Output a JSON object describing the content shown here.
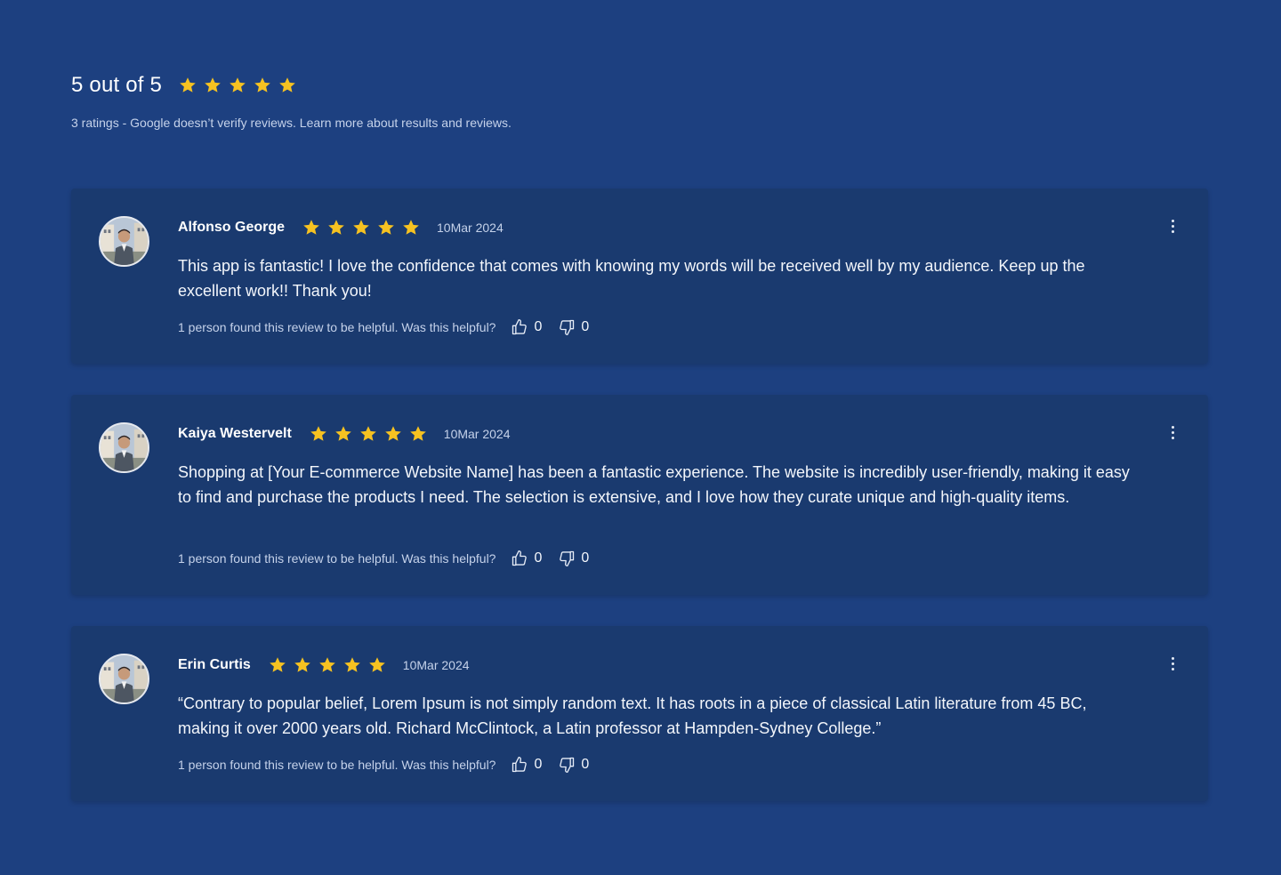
{
  "summary": {
    "title": "5 out of 5",
    "rating": 5,
    "rating_max": 5,
    "subtitle": "3 ratings - Google doesn’t verify reviews. Learn more about results and reviews."
  },
  "colors": {
    "background": "#1d4080",
    "card": "#1a3a6f",
    "star": "#f6c221",
    "muted_text": "#c5d2ea"
  },
  "icons": {
    "star": "star-icon",
    "menu": "more-vertical-icon",
    "like": "thumbs-up-icon",
    "dislike": "thumbs-down-icon"
  },
  "reviews": [
    {
      "name": "Alfonso George",
      "rating": 5,
      "date": "10Mar 2024",
      "text": "This app is fantastic! I love the confidence that comes with knowing my words will be received well by my audience. Keep up the excellent work!! Thank you!",
      "helpful_text": "1 person found this review to be helpful. Was this helpful?",
      "likes": "0",
      "dislikes": "0"
    },
    {
      "name": "Kaiya Westervelt",
      "rating": 5,
      "date": "10Mar 2024",
      "text": "Shopping at [Your E-commerce Website Name] has been a fantastic experience. The website is incredibly user-friendly, making it easy to find and purchase the products I need. The selection is extensive, and I love how they curate unique and high-quality items.",
      "helpful_text": "1 person found this review to be helpful. Was this helpful?",
      "likes": "0",
      "dislikes": "0"
    },
    {
      "name": "Erin Curtis",
      "rating": 5,
      "date": "10Mar 2024",
      "text": "“Contrary to popular belief, Lorem Ipsum is not simply random text. It has roots in a piece of classical Latin literature from 45 BC, making it over 2000 years old. Richard McClintock, a Latin professor at Hampden-Sydney College.”",
      "helpful_text": "1 person found this review to be helpful. Was this helpful?",
      "likes": "0",
      "dislikes": "0"
    }
  ]
}
